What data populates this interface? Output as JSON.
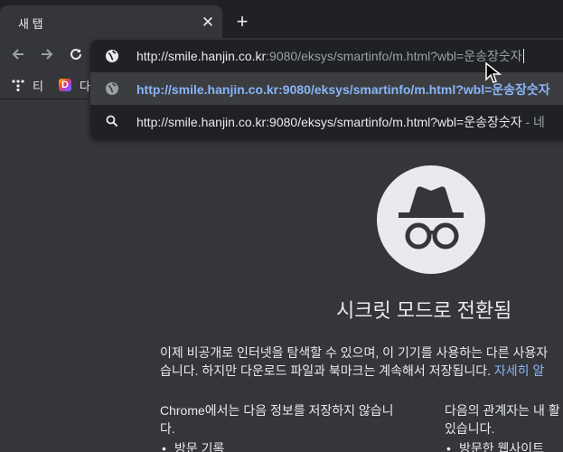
{
  "tab": {
    "title": "새 탭",
    "close_glyph": "✕",
    "new_tab_glyph": "+"
  },
  "omnibox": {
    "url_host": "http://smile.hanjin.co.kr",
    "url_rest": ":9080/eksys/smartinfo/m.html?wbl=운송장숫자"
  },
  "suggestions": [
    {
      "icon": "globe-icon",
      "text": "http://smile.hanjin.co.kr:9080/eksys/smartinfo/m.html?wbl=운송장숫자"
    },
    {
      "icon": "search-icon",
      "text": "http://smile.hanjin.co.kr:9080/eksys/smartinfo/m.html?wbl=운송장숫자",
      "description": " - 네"
    }
  ],
  "bookmarks": [
    {
      "label": "티",
      "icon": "tistory-icon"
    },
    {
      "label": "다",
      "icon": "daum-icon",
      "icon_letter": "D"
    }
  ],
  "incognito": {
    "headline": "시크릿 모드로 전환됨",
    "paragraph_line1": "이제 비공개로 인터넷을 탐색할 수 있으며, 이 기기를 사용하는 다른 사용자",
    "paragraph_line2": "습니다. 하지만 다운로드 파일과 북마크는 계속해서 저장됩니다. ",
    "learn_more": "자세히 알",
    "left_heading_line1": "Chrome에서는 다음 정보를 저장하지 않습니",
    "left_heading_line2": "다.",
    "left_item1": "방문 기록",
    "right_heading_line1": "다음의 관계자는 내 활",
    "right_heading_line2": "있습니다.",
    "right_item1": "방문한 웹사이트"
  },
  "colors": {
    "accent_link": "#8ab4f8",
    "background": "#35363a",
    "tabstrip": "#202124"
  }
}
